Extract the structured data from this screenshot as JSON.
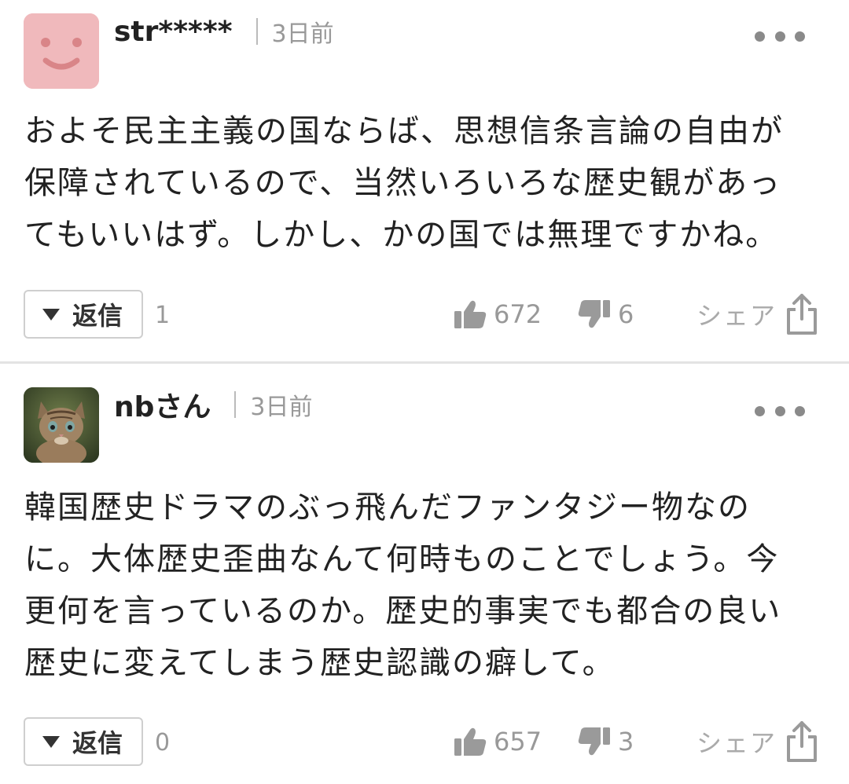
{
  "comments": [
    {
      "username": "str*****",
      "time": "3日前",
      "avatar": "smiley-avatar",
      "body_lines": [
        "およそ民主主義の国ならば、思想信条言論の自由が",
        "保障されているので、当然いろいろな歴史観があっ",
        "てもいいはず。しかし、かの国では無理ですかね。"
      ],
      "reply_label": "返信",
      "reply_count": "1",
      "likes": "672",
      "dislikes": "6",
      "share_label": "シェア"
    },
    {
      "username": "nbさん",
      "time": "3日前",
      "avatar": "kitten-photo-avatar",
      "body_lines": [
        "韓国歴史ドラマのぶっ飛んだファンタジー物なの",
        "に。大体歴史歪曲なんて何時ものことでしょう。今",
        "更何を言っているのか。歴史的事実でも都合の良い",
        "歴史に変えてしまう歴史認識の癖して。"
      ],
      "reply_label": "返信",
      "reply_count": "0",
      "likes": "657",
      "dislikes": "3",
      "share_label": "シェア"
    }
  ],
  "icons": {
    "reply_toggle": "triangle-down-icon",
    "like": "thumbs-up-icon",
    "dislike": "thumbs-down-icon",
    "share": "share-icon",
    "more": "more-dots-icon"
  },
  "colors": {
    "text": "#222222",
    "muted": "#999999",
    "icon": "#9a9a9a",
    "avatar_pink": "#f0b9bc",
    "avatar_face": "#d98588"
  }
}
